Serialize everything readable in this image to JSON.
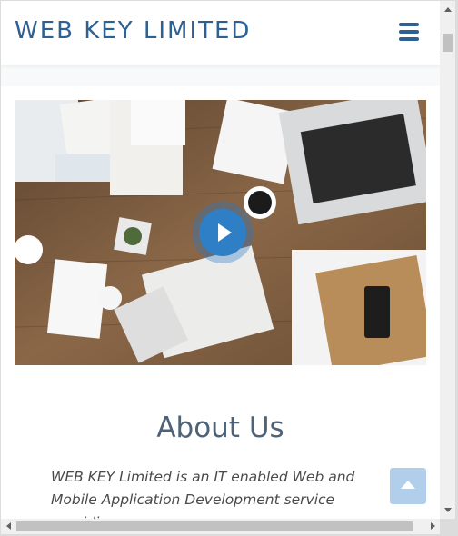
{
  "header": {
    "brand": "WEB KEY LIMITED",
    "menu_icon": "hamburger-icon"
  },
  "hero": {
    "description": "desk workspace photo with laptop, papers, phone and coffee",
    "play_icon": "play-icon"
  },
  "about": {
    "title": "About Us",
    "text": "WEB KEY Limited is an IT enabled Web and Mobile Application Development service providing company"
  },
  "back_to_top_icon": "chevron-up-icon",
  "colors": {
    "brand": "#2e6191",
    "play_button": "#2f7fc6",
    "heading": "#4f6378",
    "back_to_top": "#a9c9e9"
  }
}
